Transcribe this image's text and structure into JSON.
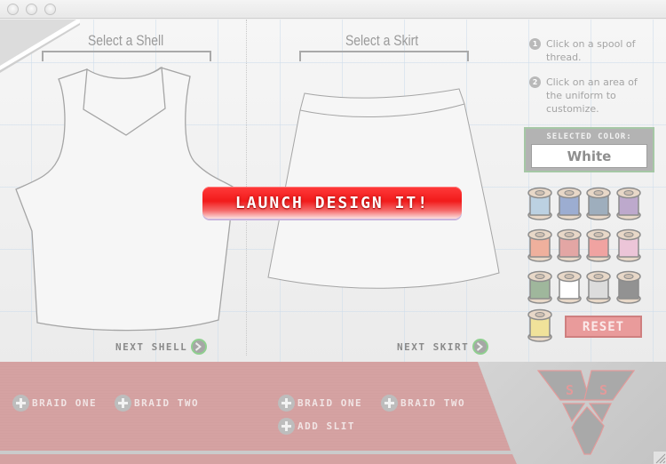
{
  "window": {
    "controls": [
      "close",
      "minimize",
      "zoom"
    ]
  },
  "shell": {
    "title": "Select a Shell",
    "next_label": "NEXT SHELL"
  },
  "skirt": {
    "title": "Select a Skirt",
    "next_label": "NEXT SKIRT"
  },
  "launch_button": "LAUNCH DESIGN IT!",
  "instructions": [
    {
      "num": "1",
      "text": "Click on a spool of thread."
    },
    {
      "num": "2",
      "text": "Click on an area of the uniform to customize."
    }
  ],
  "selected_color": {
    "label": "SELECTED COLOR:",
    "value": "White"
  },
  "spools": [
    {
      "name": "light-blue",
      "color": "#bcd1e2"
    },
    {
      "name": "periwinkle",
      "color": "#9cadd1"
    },
    {
      "name": "slate-blue",
      "color": "#9eaebd"
    },
    {
      "name": "lavender",
      "color": "#bda9cc"
    },
    {
      "name": "peach",
      "color": "#efb09d"
    },
    {
      "name": "dusty-rose",
      "color": "#e3a6a4"
    },
    {
      "name": "salmon",
      "color": "#f0a3a1"
    },
    {
      "name": "light-pink",
      "color": "#ecc5d8"
    },
    {
      "name": "sage-green",
      "color": "#9fb79c"
    },
    {
      "name": "white",
      "color": "#ffffff"
    },
    {
      "name": "light-grey",
      "color": "#dcdcdc"
    },
    {
      "name": "dark-grey",
      "color": "#929292"
    },
    {
      "name": "pale-yellow",
      "color": "#f0e29a"
    }
  ],
  "reset_label": "RESET",
  "shell_options": [
    "BRAID ONE",
    "BRAID TWO"
  ],
  "skirt_options": [
    "BRAID ONE",
    "BRAID TWO",
    "ADD SLIT"
  ],
  "logo": {
    "letters": [
      "S",
      "S"
    ]
  },
  "colors": {
    "accent_red": "#f21b1b",
    "panel_pink": "#d5a2a2",
    "reset_pink": "#e99b9b",
    "selected_border": "#a5c7a5"
  }
}
